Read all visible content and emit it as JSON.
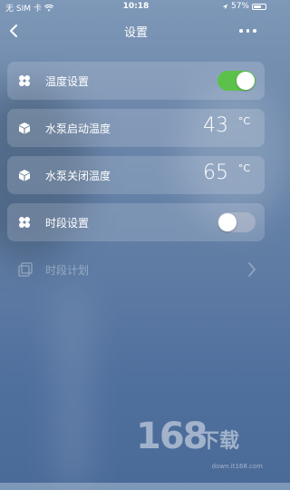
{
  "status": {
    "carrier": "无 SIM 卡",
    "time": "10:18",
    "battery": "57%"
  },
  "nav": {
    "title": "设置"
  },
  "settings": [
    {
      "label": "温度设置",
      "toggle": "on"
    },
    {
      "label": "水泵启动温度",
      "value": "43",
      "unit": "°C"
    },
    {
      "label": "水泵关闭温度",
      "value": "65",
      "unit": "°C"
    },
    {
      "label": "时段设置",
      "toggle": "off"
    }
  ],
  "schedule": {
    "label": "时段计划",
    "disabled": true
  },
  "watermark": {
    "digits": "168",
    "text": "下载",
    "url": "down.it168.com"
  },
  "colors": {
    "toggle_on": "#5cc14a",
    "background": "#5f7ca4"
  }
}
